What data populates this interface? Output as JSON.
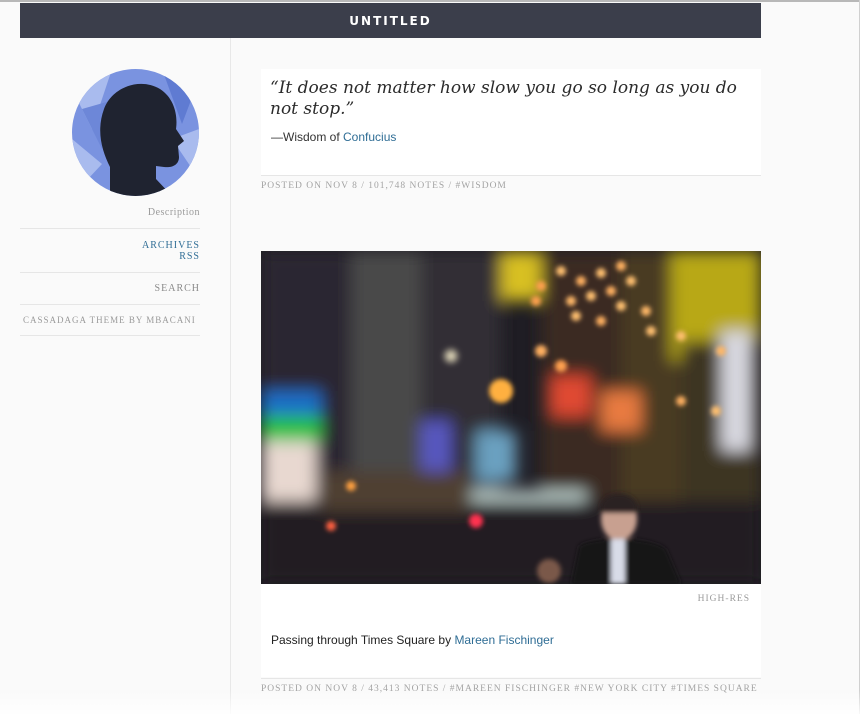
{
  "blog": {
    "title": "UNTITLED"
  },
  "sidebar": {
    "description": "Description",
    "archives": "ARCHIVES",
    "rss": "RSS",
    "search": "SEARCH",
    "credit": "CASSADAGA THEME BY MBACANI"
  },
  "posts": [
    {
      "type": "quote",
      "quote": "“It does not matter how slow you go so long as you do not stop.”",
      "source_prefix": "—Wisdom of ",
      "source_link": "Confucius",
      "meta": "POSTED ON NOV 8 / 101,748 NOTES / #WISDOM"
    },
    {
      "type": "photo",
      "hires_label": "HIGH-RES",
      "caption_prefix": "Passing through Times Square by ",
      "caption_link": "Mareen Fischinger",
      "meta": "POSTED ON NOV 8 / 43,413 NOTES / #MAREEN FISCHINGER #NEW YORK CITY #TIMES SQUARE"
    }
  ],
  "colors": {
    "header_bg": "#3b3e4b",
    "link": "#2f6d95",
    "avatar_bg": "#7a93e0"
  },
  "icons": {
    "avatar": "head-silhouette-icon"
  }
}
